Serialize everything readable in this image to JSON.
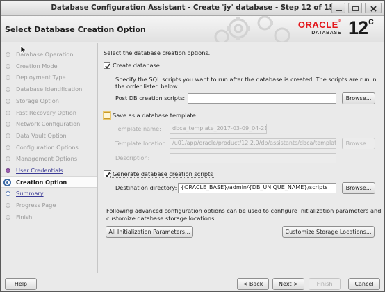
{
  "window": {
    "title": "Database Configuration Assistant - Create 'jy' database - Step 12 of 15"
  },
  "header": {
    "heading": "Select Database Creation Option",
    "brand": "ORACLE",
    "product": "DATABASE",
    "version": "12",
    "version_suffix": "c"
  },
  "sidebar": {
    "steps": [
      {
        "label": "Database Operation",
        "state": "disabled"
      },
      {
        "label": "Creation Mode",
        "state": "disabled"
      },
      {
        "label": "Deployment Type",
        "state": "disabled"
      },
      {
        "label": "Database Identification",
        "state": "disabled"
      },
      {
        "label": "Storage Option",
        "state": "disabled"
      },
      {
        "label": "Fast Recovery Option",
        "state": "disabled"
      },
      {
        "label": "Network Configuration",
        "state": "disabled"
      },
      {
        "label": "Data Vault Option",
        "state": "disabled"
      },
      {
        "label": "Configuration Options",
        "state": "disabled"
      },
      {
        "label": "Management Options",
        "state": "disabled"
      },
      {
        "label": "User Credentials",
        "state": "done"
      },
      {
        "label": "Creation Option",
        "state": "current"
      },
      {
        "label": "Summary",
        "state": "next"
      },
      {
        "label": "Progress Page",
        "state": "disabled"
      },
      {
        "label": "Finish",
        "state": "disabled"
      }
    ]
  },
  "main": {
    "intro": "Select the database creation options.",
    "create_db": {
      "label": "Create database",
      "checked": true,
      "desc_line1": "Specify the SQL scripts you want to run after the database is created. The scripts are run in",
      "desc_line2": "the order listed below.",
      "post_label": "Post DB creation scripts:",
      "post_value": "",
      "browse": "Browse..."
    },
    "template": {
      "label": "Save as a database template",
      "checked": false,
      "name_label": "Template name:",
      "name_value": "dbca_template_2017-03-09_04-21-",
      "location_label": "Template location:",
      "location_value": "/u01/app/oracle/product/12.2.0/db/assistants/dbca/template",
      "browse": "Browse...",
      "description_label": "Description:",
      "description_value": ""
    },
    "scripts": {
      "label": "Generate database creation scripts",
      "checked": true,
      "dest_label": "Destination directory:",
      "dest_value": "{ORACLE_BASE}/admin/{DB_UNIQUE_NAME}/scripts",
      "browse": "Browse..."
    },
    "advanced_line1": "Following advanced configuration options can be used to configure initialization parameters and",
    "advanced_line2": "customize database storage locations.",
    "init_params_btn": "All Initialization Parameters...",
    "storage_btn": "Customize Storage Locations..."
  },
  "footer": {
    "help": "Help",
    "back": "< Back",
    "next": "Next >",
    "finish": "Finish",
    "cancel": "Cancel"
  }
}
